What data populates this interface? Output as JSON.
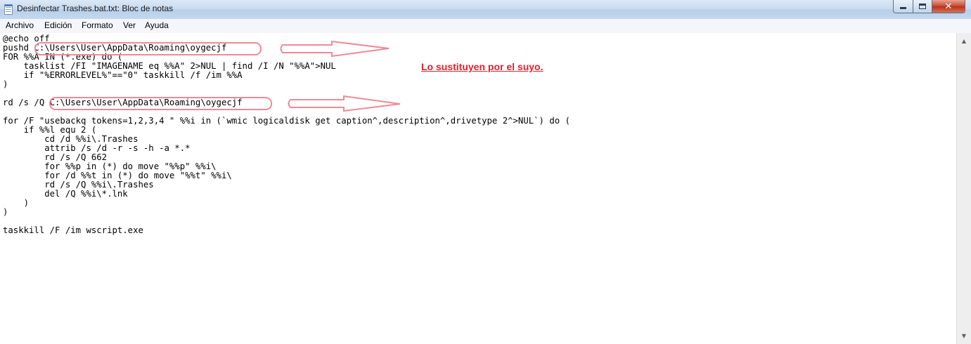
{
  "window": {
    "title": "Desinfectar Trashes.bat.txt: Bloc de notas"
  },
  "menu": [
    "Archivo",
    "Edición",
    "Formato",
    "Ver",
    "Ayuda"
  ],
  "lines": [
    "@echo off",
    "pushd C:\\Users\\User\\AppData\\Roaming\\oygecjf",
    "FOR %%A IN (*.exe) do (",
    "    tasklist /FI \"IMAGENAME eq %%A\" 2>NUL | find /I /N \"%%A\">NUL",
    "    if \"%ERRORLEVEL%\"==\"0\" taskkill /f /im %%A",
    ")",
    "rd /s /Q C:\\Users\\User\\AppData\\Roaming\\oygecjf",
    "for /F \"usebackq tokens=1,2,3,4 \" %%i in (`wmic logicaldisk get caption^,description^,drivetype 2^>NUL`) do (",
    "    if %%l equ 2 (",
    "        cd /d %%i\\.Trashes",
    "        attrib /s /d -r -s -h -a *.*",
    "        rd /s /Q 662",
    "        for %%p in (*) do move \"%%p\" %%i\\",
    "        for /d %%t in (*) do move \"%%t\" %%i\\",
    "        rd /s /Q %%i\\.Trashes",
    "        del /Q %%i\\*.lnk",
    "    )",
    ")",
    "taskkill /F /im wscript.exe"
  ],
  "annotation": {
    "note": "Lo sustituyen por el suyo.",
    "color": "#e3202a",
    "highlight_color": "#ee8a96"
  },
  "icons": [
    "notepad-icon",
    "minimize-icon",
    "maximize-icon",
    "close-icon",
    "scroll-up-icon",
    "scroll-down-icon"
  ]
}
